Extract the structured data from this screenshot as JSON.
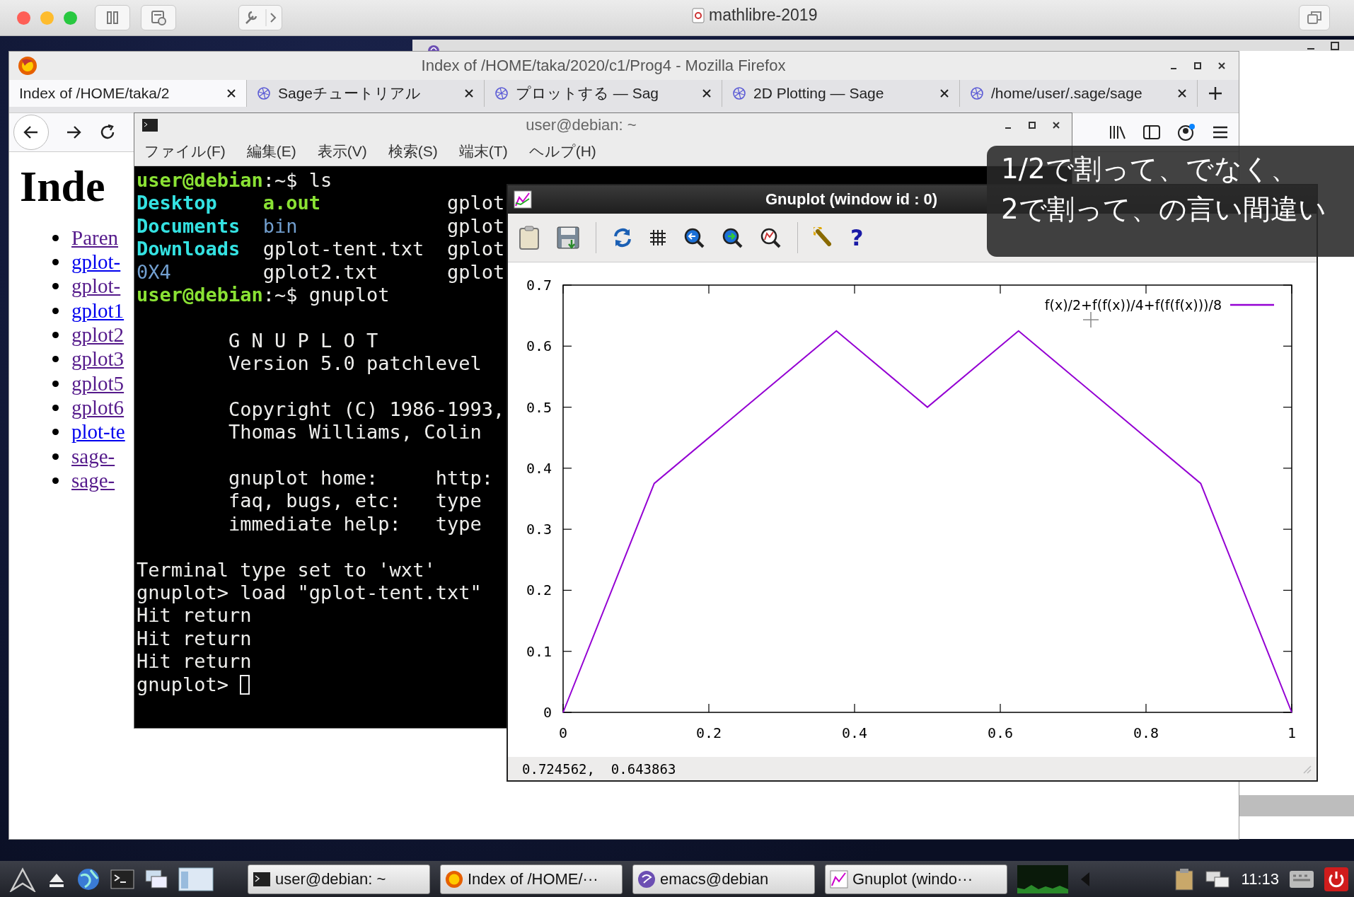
{
  "mac_window": {
    "title": "mathlibre-2019"
  },
  "firefox": {
    "title": "Index of /HOME/taka/2020/c1/Prog4 - Mozilla Firefox",
    "tabs": [
      {
        "label": "Index of /HOME/taka/2",
        "selected": true
      },
      {
        "label": "Sageチュートリアル",
        "selected": false
      },
      {
        "label": "プロットする — Sag",
        "selected": false
      },
      {
        "label": "2D Plotting — Sage",
        "selected": false
      },
      {
        "label": "/home/user/.sage/sage",
        "selected": false
      }
    ],
    "page": {
      "heading": "Inde",
      "links": [
        {
          "text": "Paren",
          "visited": true
        },
        {
          "text": "gplot-",
          "visited": false
        },
        {
          "text": "gplot-",
          "visited": true
        },
        {
          "text": "gplot1",
          "visited": false
        },
        {
          "text": "gplot2",
          "visited": true
        },
        {
          "text": "gplot3",
          "visited": true
        },
        {
          "text": "gplot5",
          "visited": true
        },
        {
          "text": "gplot6",
          "visited": true
        },
        {
          "text": "plot-te",
          "visited": false
        },
        {
          "text": "sage-",
          "visited": true
        },
        {
          "text": "sage-",
          "visited": true
        }
      ]
    }
  },
  "terminal": {
    "title": "user@debian: ~",
    "menu": [
      "ファイル(F)",
      "編集(E)",
      "表示(V)",
      "検索(S)",
      "端末(T)",
      "ヘルプ(H)"
    ],
    "lines": [
      {
        "kind": "prompt",
        "prompt": "user@debian",
        "text": ":~$ ls"
      },
      {
        "kind": "ls",
        "cells": [
          {
            "text": "Desktop",
            "kind": "link"
          },
          {
            "text": "a.out",
            "kind": "exec"
          },
          {
            "text": "gplot",
            "kind": "file"
          }
        ]
      },
      {
        "kind": "ls",
        "cells": [
          {
            "text": "Documents",
            "kind": "link"
          },
          {
            "text": "bin",
            "kind": "dir"
          },
          {
            "text": "gplot",
            "kind": "file"
          }
        ]
      },
      {
        "kind": "ls",
        "cells": [
          {
            "text": "Downloads",
            "kind": "link"
          },
          {
            "text": "gplot-tent.txt",
            "kind": "file"
          },
          {
            "text": "gplot",
            "kind": "file"
          }
        ]
      },
      {
        "kind": "ls",
        "cells": [
          {
            "text": "0X4",
            "kind": "dir"
          },
          {
            "text": "gplot2.txt",
            "kind": "file"
          },
          {
            "text": "gplot",
            "kind": "file"
          }
        ]
      },
      {
        "kind": "prompt",
        "prompt": "user@debian",
        "text": ":~$ gnuplot"
      },
      {
        "kind": "blank"
      },
      {
        "kind": "banner",
        "text": "G N U P L O T"
      },
      {
        "kind": "banner",
        "text": "Version 5.0 patchlevel"
      },
      {
        "kind": "blank"
      },
      {
        "kind": "banner",
        "text": "Copyright (C) 1986-1993,"
      },
      {
        "kind": "banner",
        "text": "Thomas Williams, Colin"
      },
      {
        "kind": "blank"
      },
      {
        "kind": "banner",
        "text": "gnuplot home:     http:"
      },
      {
        "kind": "banner",
        "text": "faq, bugs, etc:   type"
      },
      {
        "kind": "banner",
        "text": "immediate help:   type"
      },
      {
        "kind": "blank"
      },
      {
        "kind": "plain",
        "text": "Terminal type set to 'wxt'"
      },
      {
        "kind": "plain",
        "text": "gnuplot> load \"gplot-tent.txt\""
      },
      {
        "kind": "plain",
        "text": "Hit return"
      },
      {
        "kind": "plain",
        "text": "Hit return"
      },
      {
        "kind": "plain",
        "text": "Hit return"
      },
      {
        "kind": "input",
        "text": "gnuplot>"
      }
    ]
  },
  "gnuplot": {
    "title": "Gnuplot (window id : 0)",
    "toolbar": [
      {
        "kind": "copy"
      },
      {
        "kind": "save"
      },
      {
        "kind": "sep"
      },
      {
        "kind": "replot"
      },
      {
        "kind": "grid"
      },
      {
        "kind": "zoom_prev"
      },
      {
        "kind": "zoom_next"
      },
      {
        "kind": "autoscale"
      },
      {
        "kind": "sep"
      },
      {
        "kind": "config"
      },
      {
        "kind": "help",
        "label": "?"
      }
    ],
    "chart_data": {
      "type": "line",
      "x": [
        0,
        0.125,
        0.25,
        0.375,
        0.5,
        0.625,
        0.75,
        0.875,
        1
      ],
      "series": [
        {
          "name": "f(x)/2+f(f(x))/4+f(f(f(x)))/8",
          "color": "#9400d3",
          "values": [
            0,
            0.375,
            0.5,
            0.625,
            0.5,
            0.625,
            0.5,
            0.375,
            0
          ]
        }
      ],
      "xlim": [
        0,
        1
      ],
      "ylim": [
        0,
        0.7
      ],
      "xticks": [
        0,
        0.2,
        0.4,
        0.6,
        0.8,
        1
      ],
      "yticks": [
        0,
        0.1,
        0.2,
        0.3,
        0.4,
        0.5,
        0.6,
        0.7
      ]
    },
    "status": "0.724562,  0.643863"
  },
  "caption": [
    "1/2で割って、でなく、",
    "2で割って、の言い間違い"
  ],
  "taskbar": {
    "tasks": [
      {
        "kind": "terminal",
        "label": "user@debian: ~"
      },
      {
        "kind": "firefox",
        "label": "Index of /HOME/···"
      },
      {
        "kind": "emacs",
        "label": "emacs@debian"
      },
      {
        "kind": "gnuplot",
        "label": "Gnuplot (windo···"
      }
    ],
    "clock": "11:13"
  }
}
